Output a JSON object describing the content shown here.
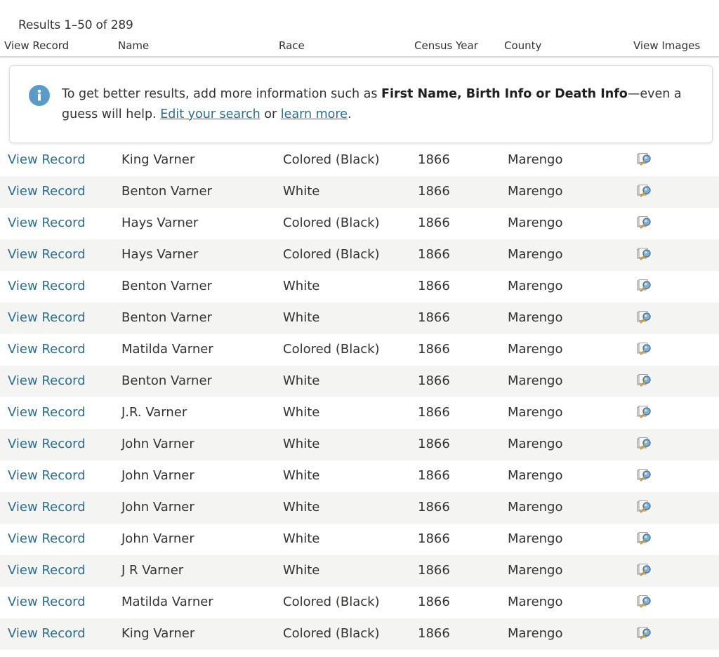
{
  "results_count": "Results 1–50 of 289",
  "columns": {
    "view_record": "View Record",
    "name": "Name",
    "race": "Race",
    "census_year": "Census Year",
    "county": "County",
    "view_images": "View Images"
  },
  "info": {
    "icon": "info-icon",
    "text_before": "To get better results, add more information such as ",
    "bold": "First Name, Birth Info or Death Info",
    "text_after": "—even a guess will help. ",
    "edit_link": "Edit your search",
    "or": " or ",
    "learn_link": "learn more",
    "period": "."
  },
  "colors": {
    "link": "#2a6e95",
    "info_icon": "#5a9cc7",
    "stripe": "#f4f4f3"
  },
  "rows": [
    {
      "link": "View Record",
      "name": "King Varner",
      "race": "Colored (Black)",
      "year": "1866",
      "county": "Marengo",
      "image_icon": "image-viewer-icon"
    },
    {
      "link": "View Record",
      "name": "Benton Varner",
      "race": "White",
      "year": "1866",
      "county": "Marengo",
      "image_icon": "image-viewer-icon"
    },
    {
      "link": "View Record",
      "name": "Hays Varner",
      "race": "Colored (Black)",
      "year": "1866",
      "county": "Marengo",
      "image_icon": "image-viewer-icon"
    },
    {
      "link": "View Record",
      "name": "Hays Varner",
      "race": "Colored (Black)",
      "year": "1866",
      "county": "Marengo",
      "image_icon": "image-viewer-icon"
    },
    {
      "link": "View Record",
      "name": "Benton Varner",
      "race": "White",
      "year": "1866",
      "county": "Marengo",
      "image_icon": "image-viewer-icon"
    },
    {
      "link": "View Record",
      "name": "Benton Varner",
      "race": "White",
      "year": "1866",
      "county": "Marengo",
      "image_icon": "image-viewer-icon"
    },
    {
      "link": "View Record",
      "name": "Matilda Varner",
      "race": "Colored (Black)",
      "year": "1866",
      "county": "Marengo",
      "image_icon": "image-viewer-icon"
    },
    {
      "link": "View Record",
      "name": "Benton Varner",
      "race": "White",
      "year": "1866",
      "county": "Marengo",
      "image_icon": "image-viewer-icon"
    },
    {
      "link": "View Record",
      "name": "J.R. Varner",
      "race": "White",
      "year": "1866",
      "county": "Marengo",
      "image_icon": "image-viewer-icon"
    },
    {
      "link": "View Record",
      "name": "John Varner",
      "race": "White",
      "year": "1866",
      "county": "Marengo",
      "image_icon": "image-viewer-icon"
    },
    {
      "link": "View Record",
      "name": "John Varner",
      "race": "White",
      "year": "1866",
      "county": "Marengo",
      "image_icon": "image-viewer-icon"
    },
    {
      "link": "View Record",
      "name": "John Varner",
      "race": "White",
      "year": "1866",
      "county": "Marengo",
      "image_icon": "image-viewer-icon"
    },
    {
      "link": "View Record",
      "name": "John Varner",
      "race": "White",
      "year": "1866",
      "county": "Marengo",
      "image_icon": "image-viewer-icon"
    },
    {
      "link": "View Record",
      "name": "J R Varner",
      "race": "White",
      "year": "1866",
      "county": "Marengo",
      "image_icon": "image-viewer-icon"
    },
    {
      "link": "View Record",
      "name": "Matilda Varner",
      "race": "Colored (Black)",
      "year": "1866",
      "county": "Marengo",
      "image_icon": "image-viewer-icon"
    },
    {
      "link": "View Record",
      "name": "King Varner",
      "race": "Colored (Black)",
      "year": "1866",
      "county": "Marengo",
      "image_icon": "image-viewer-icon"
    }
  ]
}
